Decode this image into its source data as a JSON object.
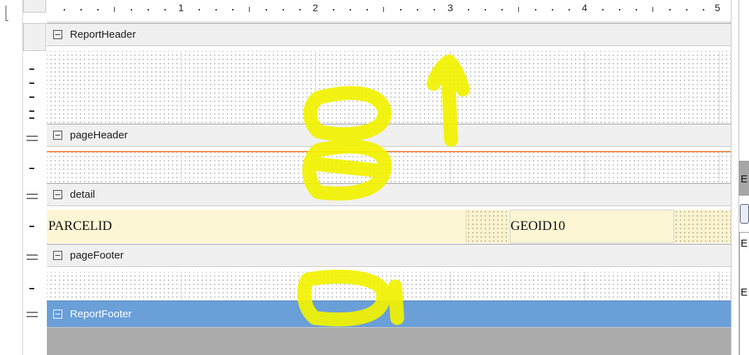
{
  "ruler": {
    "numbers": [
      "1",
      "2",
      "3",
      "4",
      "5"
    ]
  },
  "bands": {
    "report_header": "ReportHeader",
    "page_header": "pageHeader",
    "detail": "detail",
    "page_footer": "pageFooter",
    "report_footer": "ReportFooter"
  },
  "fields": {
    "parcel_id": "PARCELID",
    "geoid": "GEOID10"
  },
  "right_panel": {
    "letters": [
      "E",
      "E",
      "E"
    ]
  },
  "colors": {
    "selected_band": "#6a9fd8",
    "page_header_line": "#f08a4a",
    "field_bg": "#fdf6d4",
    "annotation": "#f5f500"
  }
}
